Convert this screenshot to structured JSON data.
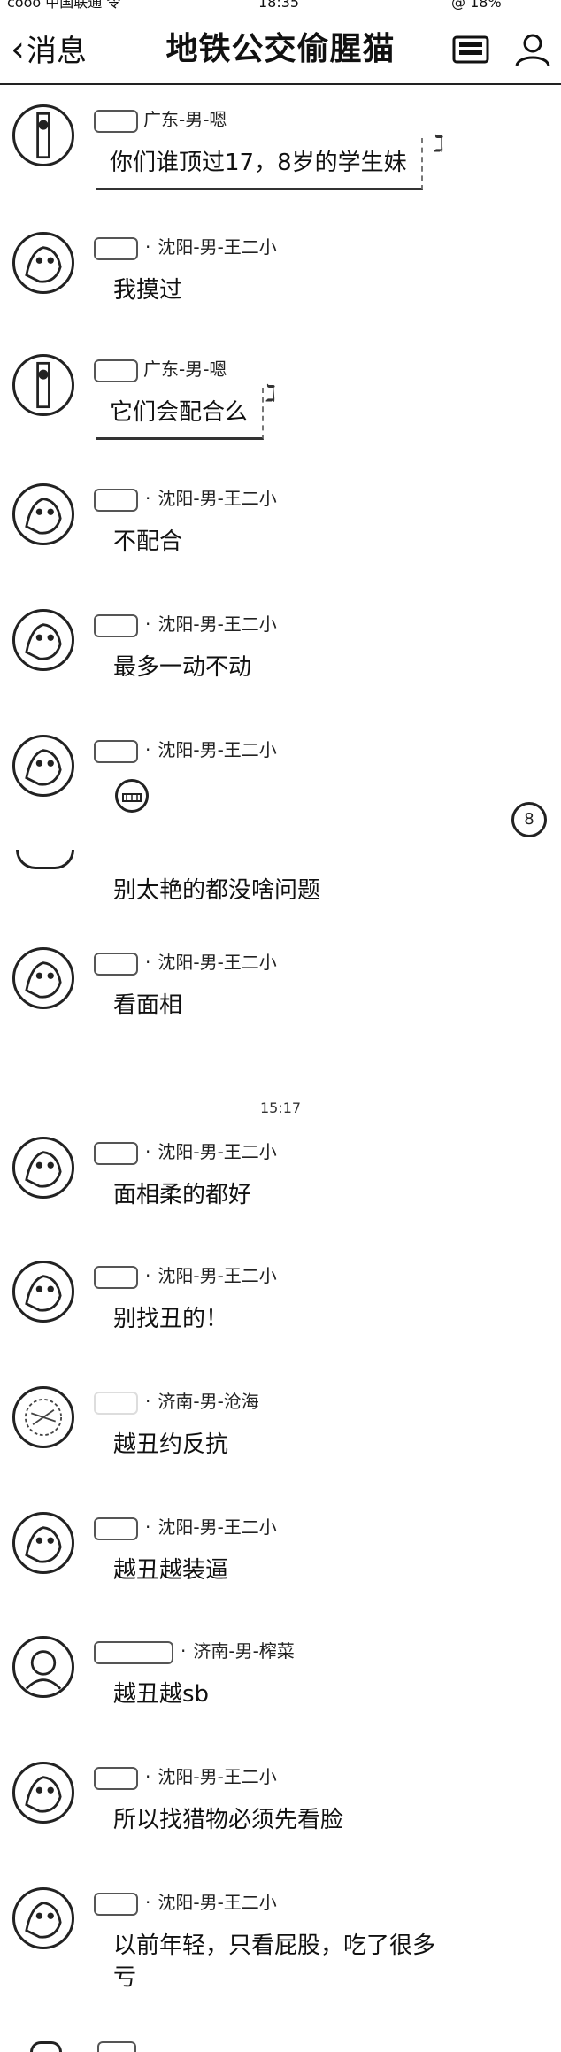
{
  "status_bar": {
    "left": "cooo 中国联通 令",
    "center": "18:35",
    "right": "@ 18%"
  },
  "nav": {
    "back_label": "消息",
    "title": "地铁公交偷腥猫",
    "icons": [
      "card-icon",
      "person-icon"
    ]
  },
  "timestamp": "15:17",
  "side_button_label": "8",
  "messages": [
    {
      "badge": "",
      "sender": "广东-男-嗯",
      "text": "你们谁顶过17，8岁的学生妹",
      "style": "bubble"
    },
    {
      "badge": "",
      "sender": "沈阳-男-王二小",
      "text": "我摸过",
      "style": "plain"
    },
    {
      "badge": "",
      "sender": "广东-男-嗯",
      "text": "它们会配合么",
      "style": "bubble"
    },
    {
      "badge": "",
      "sender": "沈阳-男-王二小",
      "text": "不配合",
      "style": "plain"
    },
    {
      "badge": "",
      "sender": "沈阳-男-王二小",
      "text": "最多一动不动",
      "style": "plain"
    },
    {
      "badge": "",
      "sender": "沈阳-男-王二小",
      "text": "",
      "style": "emoji"
    },
    {
      "badge": "",
      "sender": "",
      "text": "别太艳的都没啥问题",
      "style": "continued"
    },
    {
      "badge": "",
      "sender": "沈阳-男-王二小",
      "text": "看面相",
      "style": "plain"
    },
    {
      "badge": "",
      "sender": "沈阳-男-王二小",
      "text": "面相柔的都好",
      "style": "plain"
    },
    {
      "badge": "",
      "sender": "沈阳-男-王二小",
      "text": "别找丑的！",
      "style": "plain"
    },
    {
      "badge": "",
      "sender": "济南-男-沧海",
      "text": "越丑约反抗",
      "style": "plain"
    },
    {
      "badge": "",
      "sender": "沈阳-男-王二小",
      "text": "越丑越装逼",
      "style": "plain"
    },
    {
      "badge": "",
      "sender": "济南-男-榨菜",
      "text": "越丑越sb",
      "style": "plain"
    },
    {
      "badge": "",
      "sender": "沈阳-男-王二小",
      "text": "所以找猎物必须先看脸",
      "style": "plain"
    },
    {
      "badge": "",
      "sender": "沈阳-男-王二小",
      "text": "以前年轻，只看屁股，吃了很多亏",
      "style": "plain"
    }
  ]
}
